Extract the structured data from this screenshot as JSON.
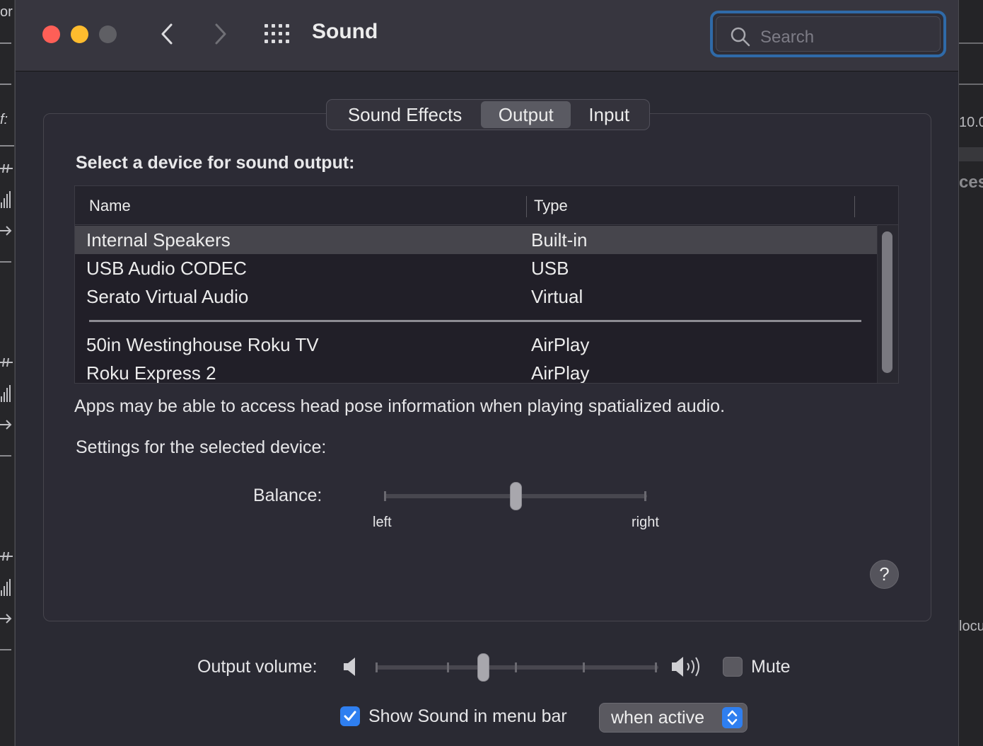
{
  "window": {
    "title": "Sound",
    "search_placeholder": "Search"
  },
  "tabs": [
    {
      "label": "Sound Effects"
    },
    {
      "label": "Output",
      "selected": true
    },
    {
      "label": "Input"
    }
  ],
  "output": {
    "heading": "Select a device for sound output:",
    "columns": {
      "name": "Name",
      "type": "Type"
    },
    "devices": [
      {
        "name": "Internal Speakers",
        "type": "Built-in",
        "selected": true
      },
      {
        "name": "USB Audio CODEC",
        "type": "USB"
      },
      {
        "name": "Serato Virtual Audio",
        "type": "Virtual"
      },
      {
        "name": "50in Westinghouse Roku TV",
        "type": "AirPlay"
      },
      {
        "name": "Roku Express 2",
        "type": "AirPlay"
      }
    ],
    "info_text": "Apps may be able to access head pose information when playing spatialized audio.",
    "settings_heading": "Settings for the selected device:",
    "balance": {
      "label": "Balance:",
      "left_label": "left",
      "right_label": "right",
      "value": 0.5
    },
    "help_label": "?"
  },
  "footer": {
    "volume_label": "Output volume:",
    "volume_value": 0.38,
    "mute_label": "Mute",
    "mute_checked": false,
    "show_in_menu_label": "Show Sound in menu bar",
    "show_in_menu_checked": true,
    "show_when_value": "when active"
  },
  "background": {
    "left_fragments": [
      "or",
      "f:"
    ],
    "right_fragments": [
      "10.0",
      "ces",
      "locu"
    ]
  },
  "colors": {
    "accent": "#2f7ff0",
    "search_focus": "#2f6aa8",
    "close": "#fe5f57",
    "minimize": "#febc2e"
  }
}
